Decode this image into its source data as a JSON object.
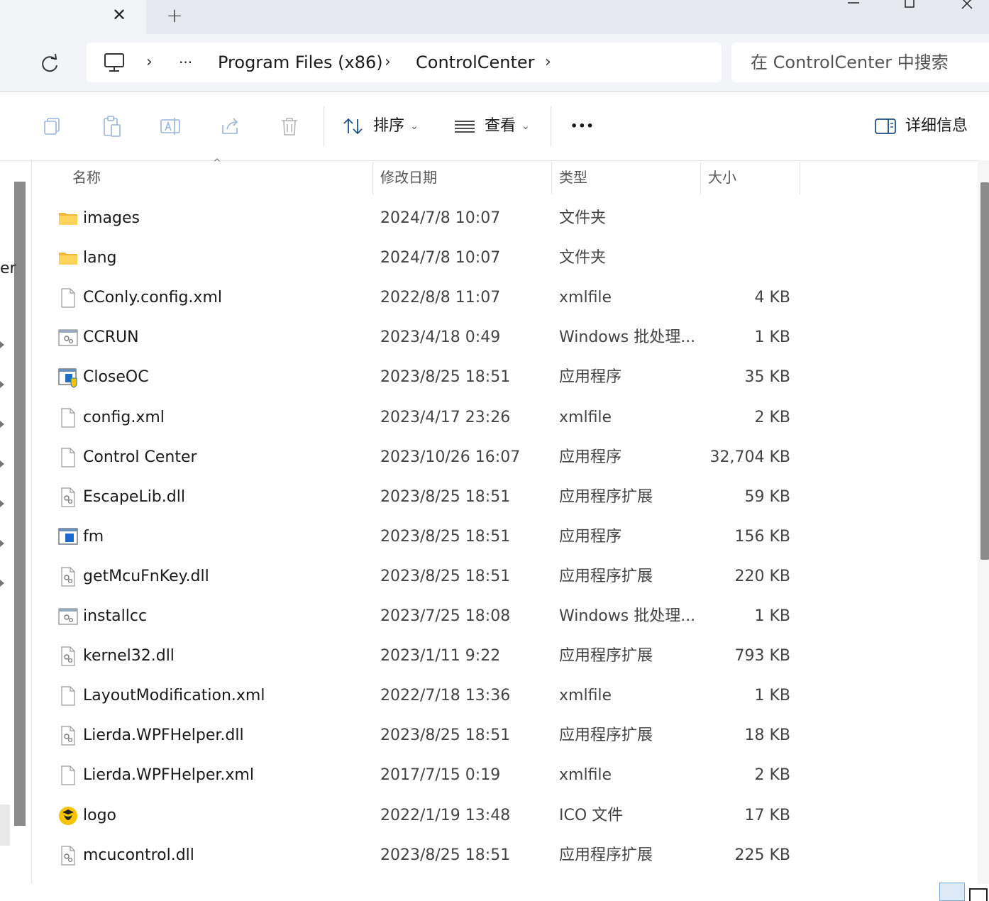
{
  "colors": {
    "tab_bg": "#e6e9ef",
    "chrome_bg": "#f3f4f7",
    "folder_yellow": "#f8c93c",
    "accent_blue": "#0b5cad"
  },
  "window": {
    "tab_close_glyph": "✕",
    "new_tab_glyph": "+"
  },
  "address": {
    "overflow": "···",
    "chevron": "›",
    "crumbs": [
      "Program Files (x86)",
      "ControlCenter"
    ],
    "search_placeholder": "在 ControlCenter 中搜索"
  },
  "toolbar": {
    "sort_label": "排序",
    "view_label": "查看",
    "more_glyph": "•••",
    "details_label": "详细信息",
    "caret": "⌄"
  },
  "nav_pane": {
    "peek_text": "er"
  },
  "columns": {
    "name": "名称",
    "date": "修改日期",
    "type": "类型",
    "size": "大小",
    "sort_glyph": "^"
  },
  "files": [
    {
      "name": "images",
      "date": "2024/7/8 10:07",
      "type": "文件夹",
      "size": "",
      "icon": "folder-icon"
    },
    {
      "name": "lang",
      "date": "2024/7/8 10:07",
      "type": "文件夹",
      "size": "",
      "icon": "folder-icon"
    },
    {
      "name": "CConly.config.xml",
      "date": "2022/8/8 11:07",
      "type": "xmlfile",
      "size": "4 KB",
      "icon": "file-icon"
    },
    {
      "name": "CCRUN",
      "date": "2023/4/18 0:49",
      "type": "Windows 批处理...",
      "size": "1 KB",
      "icon": "batch-file-icon"
    },
    {
      "name": "CloseOC",
      "date": "2023/8/25 18:51",
      "type": "应用程序",
      "size": "35 KB",
      "icon": "app-shield-icon"
    },
    {
      "name": "config.xml",
      "date": "2023/4/17 23:26",
      "type": "xmlfile",
      "size": "2 KB",
      "icon": "file-icon"
    },
    {
      "name": "Control Center",
      "date": "2023/10/26 16:07",
      "type": "应用程序",
      "size": "32,704 KB",
      "icon": "file-icon"
    },
    {
      "name": "EscapeLib.dll",
      "date": "2023/8/25 18:51",
      "type": "应用程序扩展",
      "size": "59 KB",
      "icon": "dll-file-icon"
    },
    {
      "name": "fm",
      "date": "2023/8/25 18:51",
      "type": "应用程序",
      "size": "156 KB",
      "icon": "app-icon"
    },
    {
      "name": "getMcuFnKey.dll",
      "date": "2023/8/25 18:51",
      "type": "应用程序扩展",
      "size": "220 KB",
      "icon": "dll-file-icon"
    },
    {
      "name": "installcc",
      "date": "2023/7/25 18:08",
      "type": "Windows 批处理...",
      "size": "1 KB",
      "icon": "batch-file-icon"
    },
    {
      "name": "kernel32.dll",
      "date": "2023/1/11 9:22",
      "type": "应用程序扩展",
      "size": "793 KB",
      "icon": "dll-file-icon"
    },
    {
      "name": "LayoutModification.xml",
      "date": "2022/7/18 13:36",
      "type": "xmlfile",
      "size": "1 KB",
      "icon": "file-icon"
    },
    {
      "name": "Lierda.WPFHelper.dll",
      "date": "2023/8/25 18:51",
      "type": "应用程序扩展",
      "size": "18 KB",
      "icon": "dll-file-icon"
    },
    {
      "name": "Lierda.WPFHelper.xml",
      "date": "2017/7/15 0:19",
      "type": "xmlfile",
      "size": "2 KB",
      "icon": "file-icon"
    },
    {
      "name": "logo",
      "date": "2022/1/19 13:48",
      "type": "ICO 文件",
      "size": "17 KB",
      "icon": "logo-ico-icon"
    },
    {
      "name": "mcucontrol.dll",
      "date": "2023/8/25 18:51",
      "type": "应用程序扩展",
      "size": "225 KB",
      "icon": "dll-file-icon"
    }
  ]
}
